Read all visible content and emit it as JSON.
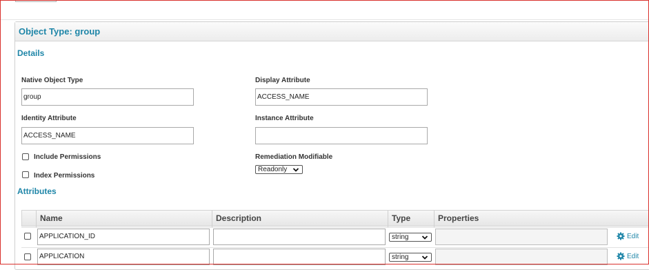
{
  "panel": {
    "title": "Object Type: group"
  },
  "details": {
    "section_title": "Details",
    "native_object_type": {
      "label": "Native Object Type",
      "value": "group"
    },
    "display_attribute": {
      "label": "Display Attribute",
      "value": "ACCESS_NAME"
    },
    "identity_attribute": {
      "label": "Identity Attribute",
      "value": "ACCESS_NAME"
    },
    "instance_attribute": {
      "label": "Instance Attribute",
      "value": ""
    },
    "include_permissions": {
      "label": "Include Permissions",
      "checked": false
    },
    "index_permissions": {
      "label": "Index Permissions",
      "checked": false
    },
    "remediation_modifiable": {
      "label": "Remediation Modifiable",
      "value": "Readonly"
    }
  },
  "attributes": {
    "section_title": "Attributes",
    "columns": [
      "Name",
      "Description",
      "Type",
      "Properties"
    ],
    "rows": [
      {
        "name": "APPLICATION_ID",
        "description": "",
        "type": "string",
        "properties": "",
        "edit_label": "Edit"
      },
      {
        "name": "APPLICATION",
        "description": "",
        "type": "string",
        "properties": "",
        "edit_label": "Edit"
      }
    ]
  },
  "colors": {
    "accent": "#1f86a8",
    "frame": "#d9302c"
  },
  "icons": {
    "edit": "gear-icon",
    "dropdown": "chevron-down-icon"
  }
}
